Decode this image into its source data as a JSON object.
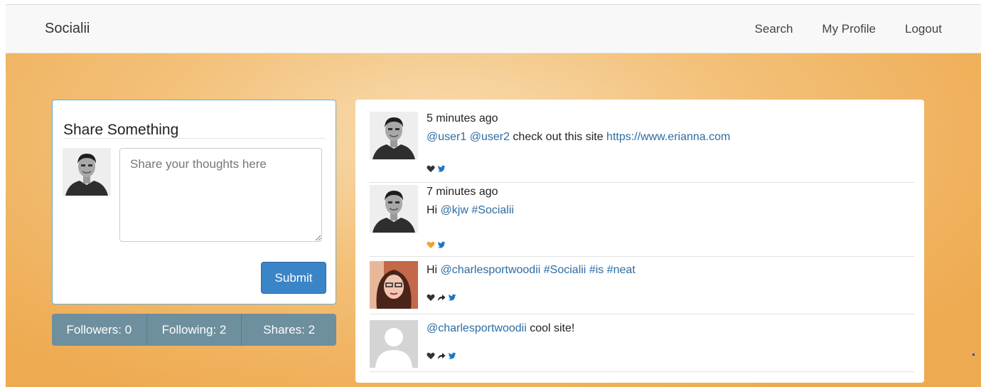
{
  "navbar": {
    "brand": "Socialii",
    "links": [
      "Search",
      "My Profile",
      "Logout"
    ]
  },
  "share": {
    "title": "Share Something",
    "placeholder": "Share your thoughts here",
    "submit_label": "Submit"
  },
  "stats": [
    "Followers: 0",
    "Following: 2",
    "Shares: 2"
  ],
  "feed": [
    {
      "time": "5 minutes ago",
      "parts": [
        {
          "text": "@user1",
          "link": true
        },
        {
          "text": " ",
          "link": false
        },
        {
          "text": "@user2",
          "link": true
        },
        {
          "text": " check out this site ",
          "link": false
        },
        {
          "text": "https://www.erianna.com",
          "link": true
        }
      ],
      "actions": [
        "heart-icon",
        "twitter-icon"
      ],
      "heart_color": "#333333",
      "avatar": "man"
    },
    {
      "time": "7 minutes ago",
      "parts": [
        {
          "text": "Hi ",
          "link": false
        },
        {
          "text": "@kjw",
          "link": true
        },
        {
          "text": " ",
          "link": false
        },
        {
          "text": "#Socialii",
          "link": true
        }
      ],
      "actions": [
        "heart-icon",
        "twitter-icon"
      ],
      "heart_color": "#f0a030",
      "avatar": "man"
    },
    {
      "time": "",
      "parts": [
        {
          "text": "Hi ",
          "link": false
        },
        {
          "text": "@charlesportwoodii",
          "link": true
        },
        {
          "text": " ",
          "link": false
        },
        {
          "text": "#Socialii",
          "link": true
        },
        {
          "text": " ",
          "link": false
        },
        {
          "text": "#is",
          "link": true
        },
        {
          "text": " ",
          "link": false
        },
        {
          "text": "#neat",
          "link": true
        }
      ],
      "actions": [
        "heart-icon",
        "share-icon",
        "twitter-icon"
      ],
      "heart_color": "#333333",
      "avatar": "woman"
    },
    {
      "time": "",
      "parts": [
        {
          "text": "@charlesportwoodii",
          "link": true
        },
        {
          "text": " cool site!",
          "link": false
        }
      ],
      "actions": [
        "heart-icon",
        "share-icon",
        "twitter-icon"
      ],
      "heart_color": "#333333",
      "avatar": "default"
    }
  ],
  "colors": {
    "accent": "#3a84c8",
    "link": "#2d6ca2",
    "stats_bar": "#6e8f9e",
    "twitter": "#1f78c1"
  }
}
